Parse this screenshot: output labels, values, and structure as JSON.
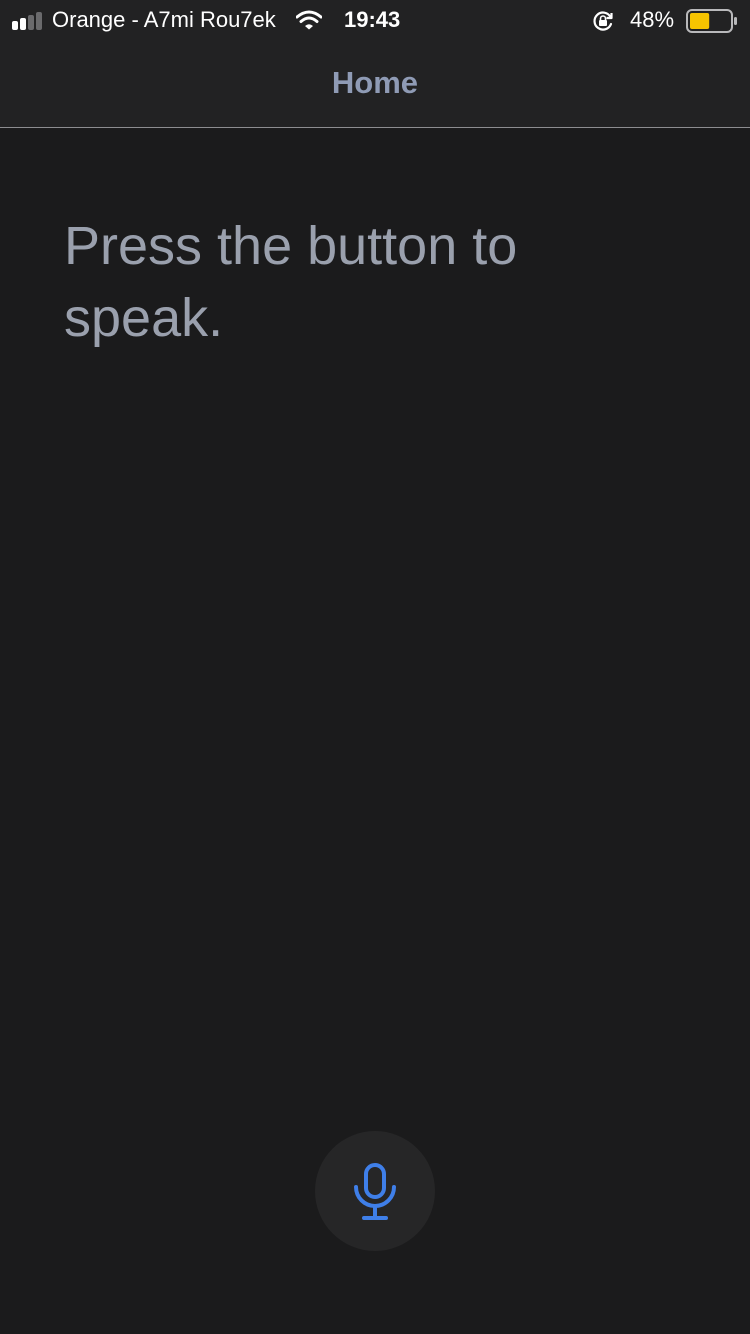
{
  "status_bar": {
    "carrier": "Orange - A7mi Rou7ek",
    "time": "19:43",
    "battery_percent": "48%",
    "battery_level": 0.48,
    "signal_bars_filled": 2,
    "signal_bars_total": 4,
    "icons": [
      "signal-icon",
      "wifi-icon",
      "rotation-lock-icon",
      "battery-icon"
    ]
  },
  "nav": {
    "title": "Home"
  },
  "main": {
    "prompt": "Press the button to speak."
  },
  "mic_button": {
    "icon": "microphone-icon"
  },
  "colors": {
    "background": "#1b1b1c",
    "bar": "#222223",
    "title": "#8f9bb5",
    "prompt": "#9aa0ad",
    "accent": "#3f7fe9",
    "battery": "#f7c400"
  }
}
